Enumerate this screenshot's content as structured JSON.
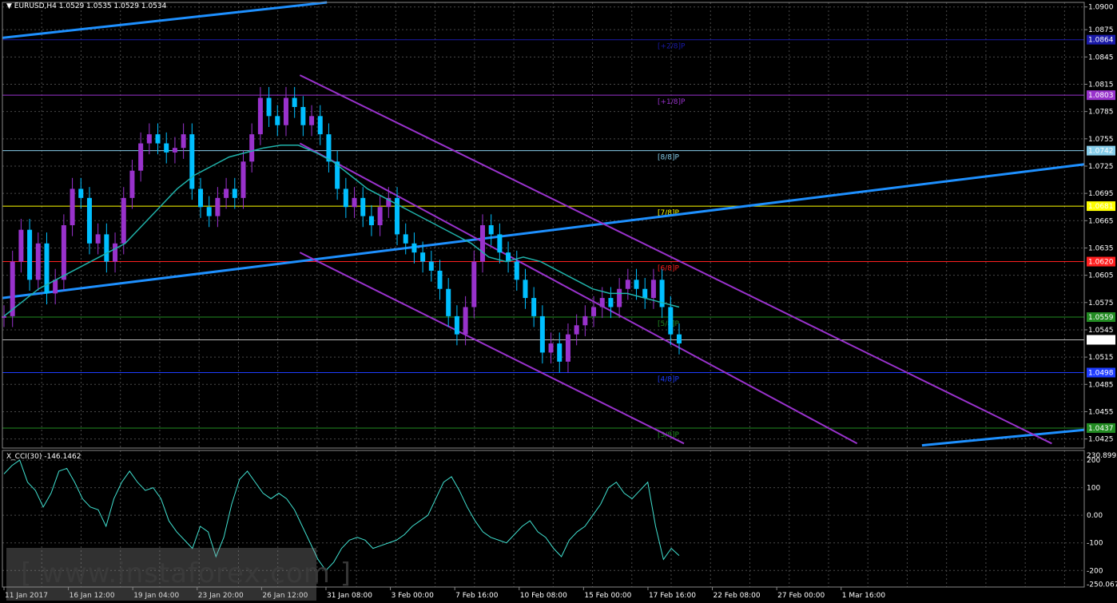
{
  "header": {
    "symbol": "EURUSD,H4",
    "ohlc": "1.0529 1.0535 1.0529 1.0534",
    "cci_label": "X_CCI(30) -146.1462"
  },
  "watermark": {
    "text": "[ www.instaforex.com ]"
  },
  "colors": {
    "background": "#000000",
    "grid": "#4a4a4a",
    "bull_candle": "#9932CC",
    "bear_candle": "#00BFFF",
    "trendline": "#1E90FF",
    "channel": "#9932CC",
    "ma": "#20B2AA",
    "cci": "#40E0D0"
  },
  "chart_data": [
    {
      "type": "line",
      "title": "EURUSD,H4",
      "y_axis_ticks": [
        "1.0900",
        "1.0875",
        "1.0845",
        "1.0815",
        "1.0785",
        "1.0755",
        "1.0725",
        "1.0695",
        "1.0665",
        "1.0635",
        "1.0605",
        "1.0575",
        "1.0545",
        "1.0515",
        "1.0485",
        "1.0455",
        "1.0425"
      ],
      "ylim": [
        1.0415,
        1.0905
      ],
      "x_axis_ticks": [
        "11 Jan 2017",
        "16 Jan 12:00",
        "19 Jan 04:00",
        "23 Jan 20:00",
        "26 Jan 12:00",
        "31 Jan 08:00",
        "3 Feb 00:00",
        "7 Feb 16:00",
        "10 Feb 08:00",
        "15 Feb 00:00",
        "17 Feb 16:00",
        "22 Feb 08:00",
        "27 Feb 00:00",
        "1 Mar 16:00"
      ],
      "murrey_levels": [
        {
          "name": "[+2/8]P",
          "price": 1.0864,
          "color": "#1a1aa8",
          "tag": "1.0864"
        },
        {
          "name": "[+1/8]P",
          "price": 1.0803,
          "color": "#9932CC",
          "tag": "1.0803"
        },
        {
          "name": "[8/8]P",
          "price": 1.0742,
          "color": "#87CEEB",
          "tag": "1.0742"
        },
        {
          "name": "[7/8]P",
          "price": 1.0681,
          "color": "#FFFF00",
          "tag": "1.0681"
        },
        {
          "name": "[6/8]P",
          "price": 1.062,
          "color": "#FF2020",
          "tag": "1.0620"
        },
        {
          "name": "[5/8]P",
          "price": 1.0559,
          "color": "#228B22",
          "tag": "1.0559"
        },
        {
          "name": "[4/8]P",
          "price": 1.0498,
          "color": "#1E3CFF",
          "tag": "1.0498"
        },
        {
          "name": "[3/8]P",
          "price": 1.0437,
          "color": "#228B22",
          "tag": "1.0437"
        }
      ],
      "current_price": {
        "price": 1.0534,
        "tag": "1.0534"
      },
      "price_path": [
        1.056,
        1.062,
        1.0655,
        1.06,
        1.064,
        1.0585,
        1.06,
        1.066,
        1.07,
        1.069,
        1.064,
        1.065,
        1.062,
        1.064,
        1.069,
        1.072,
        1.075,
        1.076,
        1.075,
        1.074,
        1.0745,
        1.076,
        1.07,
        1.068,
        1.067,
        1.069,
        1.07,
        1.069,
        1.073,
        1.076,
        1.08,
        1.078,
        1.077,
        1.08,
        1.079,
        1.077,
        1.078,
        1.076,
        1.073,
        1.07,
        1.068,
        1.069,
        1.067,
        1.066,
        1.068,
        1.069,
        1.065,
        1.064,
        1.063,
        1.062,
        1.061,
        1.059,
        1.056,
        1.054,
        1.057,
        1.062,
        1.066,
        1.065,
        1.063,
        1.062,
        1.06,
        1.058,
        1.056,
        1.052,
        1.053,
        1.051,
        1.054,
        1.055,
        1.056,
        1.057,
        1.058,
        1.057,
        1.059,
        1.06,
        1.059,
        1.058,
        1.06,
        1.057,
        1.054,
        1.053
      ],
      "ma_path": [
        1.056,
        1.0575,
        1.059,
        1.06,
        1.061,
        1.062,
        1.063,
        1.064,
        1.066,
        1.068,
        1.07,
        1.0715,
        1.0725,
        1.0735,
        1.074,
        1.0745,
        1.0748,
        1.0748,
        1.074,
        1.073,
        1.0715,
        1.07,
        1.069,
        1.068,
        1.067,
        1.066,
        1.065,
        1.064,
        1.0625,
        1.062,
        1.0625,
        1.062,
        1.061,
        1.06,
        1.059,
        1.0585,
        1.0585,
        1.058,
        1.0575,
        1.057
      ],
      "trendline_upper_segment": {
        "from": [
          0,
          1.0866
        ],
        "to": [
          0.3,
          1.0905
        ]
      },
      "trendline_long": {
        "from": [
          0,
          1.058
        ],
        "to": [
          1,
          1.0727
        ]
      },
      "trendline_bottom": {
        "from": [
          0.85,
          1.0418
        ],
        "to": [
          1,
          1.0435
        ]
      },
      "channel_upper": {
        "from": [
          0.275,
          1.0825
        ],
        "to": [
          0.97,
          1.042
        ]
      },
      "channel_middle": {
        "from": [
          0.275,
          1.075
        ],
        "to": [
          0.79,
          1.042
        ]
      },
      "channel_lower": {
        "from": [
          0.275,
          1.063
        ],
        "to": [
          0.63,
          1.042
        ]
      }
    },
    {
      "type": "line",
      "title": "X_CCI(30) -146.1462",
      "y_axis_ticks": [
        "230.8992",
        "200",
        "100",
        "0.00",
        "-100",
        "-200",
        "-250.067"
      ],
      "ylim": [
        -260,
        235
      ],
      "values": [
        150,
        180,
        200,
        120,
        90,
        30,
        80,
        160,
        170,
        120,
        60,
        30,
        20,
        -40,
        60,
        120,
        160,
        120,
        90,
        100,
        60,
        -20,
        -60,
        -90,
        -120,
        -40,
        -60,
        -150,
        -80,
        40,
        130,
        160,
        120,
        80,
        60,
        80,
        60,
        20,
        -40,
        -100,
        -160,
        -200,
        -170,
        -120,
        -90,
        -80,
        -90,
        -120,
        -110,
        -100,
        -90,
        -70,
        -40,
        -20,
        0,
        60,
        120,
        140,
        90,
        30,
        -20,
        -60,
        -80,
        -90,
        -100,
        -70,
        -40,
        -20,
        -60,
        -80,
        -120,
        -150,
        -90,
        -60,
        -40,
        0,
        40,
        100,
        120,
        80,
        60,
        90,
        120,
        -40,
        -160,
        -120,
        -146
      ]
    }
  ]
}
